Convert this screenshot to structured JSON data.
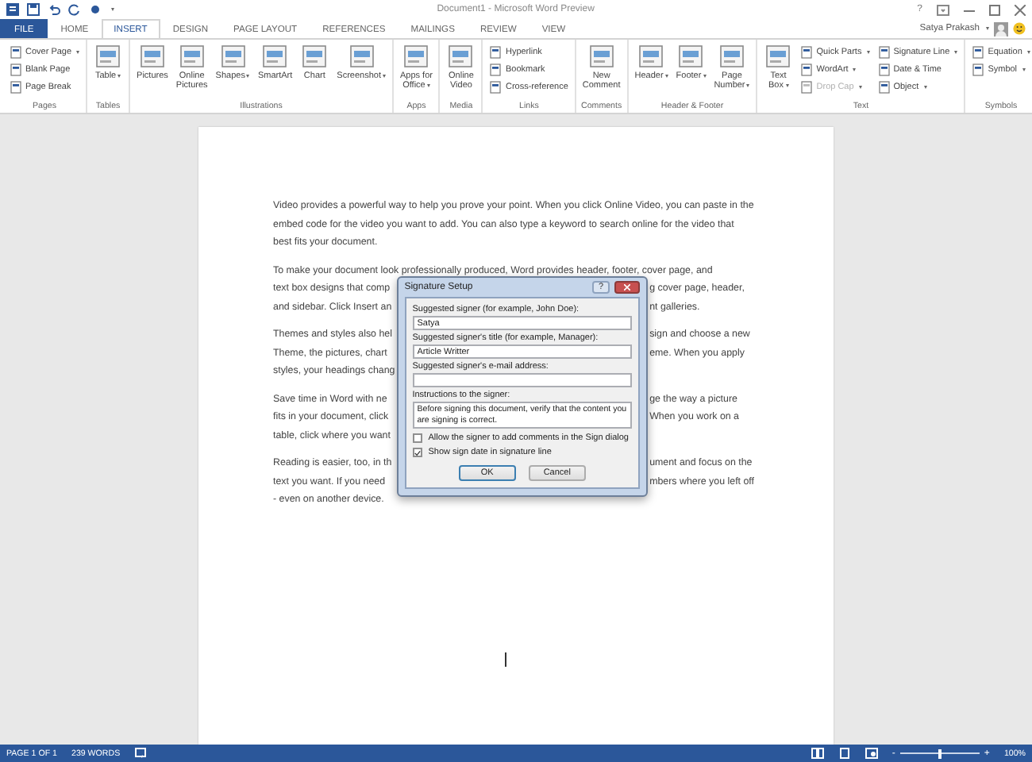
{
  "window": {
    "title": "Document1 - Microsoft Word Preview",
    "help": "?"
  },
  "user": {
    "name": "Satya Prakash"
  },
  "tabs": [
    {
      "label": "FILE",
      "kind": "file",
      "selected": false
    },
    {
      "label": "HOME",
      "kind": "tab",
      "selected": false
    },
    {
      "label": "INSERT",
      "kind": "tab",
      "selected": true
    },
    {
      "label": "DESIGN",
      "kind": "tab",
      "selected": false
    },
    {
      "label": "PAGE LAYOUT",
      "kind": "tab",
      "selected": false
    },
    {
      "label": "REFERENCES",
      "kind": "tab",
      "selected": false
    },
    {
      "label": "MAILINGS",
      "kind": "tab",
      "selected": false
    },
    {
      "label": "REVIEW",
      "kind": "tab",
      "selected": false
    },
    {
      "label": "VIEW",
      "kind": "tab",
      "selected": false
    }
  ],
  "ribbon": [
    {
      "label": "Pages",
      "columns": [
        {
          "kind": "stack",
          "items": [
            {
              "label": "Cover Page",
              "menu": true,
              "disabled": false
            },
            {
              "label": "Blank Page",
              "menu": false,
              "disabled": false
            },
            {
              "label": "Page Break",
              "menu": false,
              "disabled": false
            }
          ]
        }
      ]
    },
    {
      "label": "Tables",
      "columns": [
        {
          "kind": "large",
          "label": "Table",
          "menu": true
        }
      ]
    },
    {
      "label": "Illustrations",
      "columns": [
        {
          "kind": "large",
          "label": "Pictures",
          "menu": false
        },
        {
          "kind": "large",
          "label": "Online\nPictures",
          "menu": false
        },
        {
          "kind": "large",
          "label": "Shapes",
          "menu": true
        },
        {
          "kind": "large",
          "label": "SmartArt",
          "menu": false
        },
        {
          "kind": "large",
          "label": "Chart",
          "menu": false
        },
        {
          "kind": "large",
          "label": "Screenshot",
          "menu": true
        }
      ]
    },
    {
      "label": "Apps",
      "columns": [
        {
          "kind": "large",
          "label": "Apps for\nOffice",
          "menu": true
        }
      ]
    },
    {
      "label": "Media",
      "columns": [
        {
          "kind": "large",
          "label": "Online\nVideo",
          "menu": false
        }
      ]
    },
    {
      "label": "Links",
      "columns": [
        {
          "kind": "stack",
          "items": [
            {
              "label": "Hyperlink",
              "menu": false,
              "disabled": false
            },
            {
              "label": "Bookmark",
              "menu": false,
              "disabled": false
            },
            {
              "label": "Cross-reference",
              "menu": false,
              "disabled": false
            }
          ]
        }
      ]
    },
    {
      "label": "Comments",
      "columns": [
        {
          "kind": "large",
          "label": "New\nComment",
          "menu": false
        }
      ]
    },
    {
      "label": "Header & Footer",
      "columns": [
        {
          "kind": "large",
          "label": "Header",
          "menu": true
        },
        {
          "kind": "large",
          "label": "Footer",
          "menu": true
        },
        {
          "kind": "large",
          "label": "Page\nNumber",
          "menu": true
        }
      ]
    },
    {
      "label": "Text",
      "columns": [
        {
          "kind": "large",
          "label": "Text\nBox",
          "menu": true
        },
        {
          "kind": "stack",
          "items": [
            {
              "label": "Quick Parts",
              "menu": true,
              "disabled": false
            },
            {
              "label": "WordArt",
              "menu": true,
              "disabled": false
            },
            {
              "label": "Drop Cap",
              "menu": true,
              "disabled": true
            }
          ]
        },
        {
          "kind": "stack",
          "items": [
            {
              "label": "Signature Line",
              "menu": true,
              "disabled": false
            },
            {
              "label": "Date & Time",
              "menu": false,
              "disabled": false
            },
            {
              "label": "Object",
              "menu": true,
              "disabled": false
            }
          ]
        }
      ]
    },
    {
      "label": "Symbols",
      "columns": [
        {
          "kind": "stack",
          "items": [
            {
              "label": "Equation",
              "menu": true,
              "disabled": false
            },
            {
              "label": "Symbol",
              "menu": true,
              "disabled": false
            }
          ]
        }
      ]
    }
  ],
  "document": {
    "first_paragraph": "Video provides a powerful way to help you prove your point. When you click Online Video, you can paste in the embed code for the video you want to add. You can also type a keyword to search online for the video that best fits your document.",
    "second_paragraph_first_line": "To make your document look professionally produced, Word provides header, footer, cover page, and",
    "partly_covered_paragraphs": [
      [
        {
          "left": "text box designs that comp",
          "right": "g cover page, header,"
        },
        {
          "left": "and sidebar. Click Insert an",
          "right": "nt galleries."
        }
      ],
      [
        {
          "left": "Themes and styles also hel",
          "right": "sign and choose a new"
        },
        {
          "left": "Theme, the pictures, chart",
          "right": "eme. When you apply"
        },
        {
          "left": "styles, your headings chang"
        }
      ],
      [
        {
          "left": "Save time in Word with ne",
          "right": "ge the way a picture"
        },
        {
          "left": "fits in your document, click",
          "right": "When you work on a"
        },
        {
          "left": "table, click where you want"
        }
      ],
      [
        {
          "left": "Reading is easier, too, in th",
          "right": "ument and focus on the"
        },
        {
          "left": "text you want. If you need",
          "right": "mbers where you left off"
        },
        {
          "left": "- even on another device."
        }
      ]
    ]
  },
  "dialog": {
    "title": "Signature Setup",
    "help": "?",
    "fields": [
      {
        "label": "Suggested signer (for example, John Doe):",
        "value": "Satya",
        "kind": "line"
      },
      {
        "label": "Suggested signer's title (for example, Manager):",
        "value": "Article Writter",
        "kind": "line"
      },
      {
        "label": "Suggested signer's e-mail address:",
        "kind": "line"
      },
      {
        "label": "Instructions to the signer:",
        "value": "Before signing this document, verify that the content you are signing is correct.",
        "kind": "area"
      }
    ],
    "checkboxes": [
      {
        "label": "Allow the signer to add comments in the Sign dialog",
        "checked": false
      },
      {
        "label": "Show sign date in signature line",
        "checked": true
      }
    ],
    "buttons": [
      {
        "label": "OK",
        "default": true
      },
      {
        "label": "Cancel",
        "default": false
      }
    ]
  },
  "status_bar": {
    "page": "PAGE 1 OF 1",
    "words": "239 WORDS",
    "zoom_out": "-",
    "zoom_in": "+",
    "zoom": "100%",
    "level": 0.5
  }
}
